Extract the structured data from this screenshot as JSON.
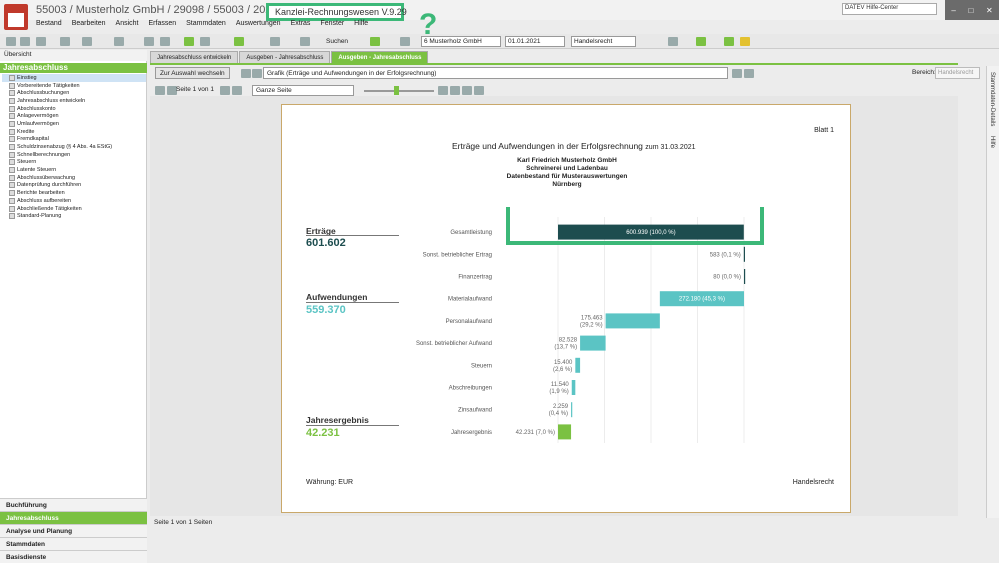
{
  "window": {
    "title": "55003 / Musterholz GmbH / 29098 / 55003 / 2021 - JA",
    "version": "Kanzlei-Rechnungswesen V.9.29",
    "help_center": "DATEV Hilfe-Center",
    "annotation_mark": "?"
  },
  "menu": [
    "Bestand",
    "Bearbeiten",
    "Ansicht",
    "Erfassen",
    "Stammdaten",
    "Auswertungen",
    "Extras",
    "Fenster",
    "Hilfe"
  ],
  "toolbar": {
    "search_label": "Suchen",
    "client": "6 Musterholz GmbH",
    "date": "01.01.2021",
    "law": "Handelsrecht"
  },
  "left": {
    "overview": "Übersicht",
    "section": "Jahresabschluss",
    "tree": [
      "Einstieg",
      "Vorbereitende Tätigkeiten",
      "Abschlussbuchungen",
      "Jahresabschluss entwickeln",
      "Abschlusskonto",
      "Anlagevermögen",
      "Umlaufvermögen",
      "Kredite",
      "Fremdkapital",
      "Schuldzinsenabzug (§ 4 Abs. 4a EStG)",
      "Schnellberechnungen",
      "Steuern",
      "Latente Steuern",
      "Abschlussüberwachung",
      "Datenprüfung durchführen",
      "Berichte bearbeiten",
      "Abschluss aufbereiten",
      "Abschließende Tätigkeiten",
      "Standard-Planung"
    ],
    "nav": [
      "Buchführung",
      "Jahresabschluss",
      "Analyse und Planung",
      "Stammdaten",
      "Basisdienste"
    ]
  },
  "tabs": [
    "Jahresabschluss entwickeln",
    "Ausgeben - Jahresabschluss",
    "Ausgeben - Jahresabschluss"
  ],
  "viewer": {
    "back_button": "Zur Auswahl wechseln",
    "report": "Grafik (Erträge und Aufwendungen in der Erfolgsrechnung)",
    "bereich_label": "Bereich:",
    "bereich_value": "Handelsrecht",
    "page_info": "Seite 1 von 1",
    "zoom": "Ganze Seite"
  },
  "right_strip": [
    "Stammdaten-Details",
    "Hilfe"
  ],
  "status": "Seite 1 von 1 Seiten",
  "report": {
    "sheet": "Blatt 1",
    "title": "Erträge und Aufwendungen in der Erfolgsrechnung",
    "date_suffix": "zum 31.03.2021",
    "company": [
      "Karl Friedrich Musterholz GmbH",
      "Schreinerei und Ladenbau",
      "Datenbestand für Musterauswertungen",
      "Nürnberg"
    ],
    "summary": [
      {
        "label": "Erträge",
        "value": "601.602",
        "color": "#1d4d4f"
      },
      {
        "label": "Aufwendungen",
        "value": "559.370",
        "color": "#5bc4c4"
      },
      {
        "label": "Jahresergebnis",
        "value": "42.231",
        "color": "#7bc142"
      }
    ],
    "currency": "Währung: EUR",
    "law": "Handelsrecht"
  },
  "chart_data": {
    "type": "bar",
    "categories": [
      "Gesamtleistung",
      "Sonst. betrieblicher Ertrag",
      "Finanzertrag",
      "Materialaufwand",
      "Personalaufwand",
      "Sonst. betrieblicher Aufwand",
      "Steuern",
      "Abschreibungen",
      "Zinsaufwand",
      "Jahresergebnis"
    ],
    "values": [
      600939,
      583,
      80,
      272180,
      175463,
      82528,
      15400,
      11540,
      2259,
      42231
    ],
    "labels": [
      "600.939 (100,0 %)",
      "583 (0,1 %)",
      "80 (0,0 %)",
      "272.180 (45,3 %)",
      "175.463|(29,2 %)",
      "82.528|(13,7 %)",
      "15.400|(2,6 %)",
      "11.540|(1,9 %)",
      "2.259|(0,4 %)",
      "42.231 (7,0 %)"
    ],
    "colors": [
      "#1d4d4f",
      "#1d4d4f",
      "#1d4d4f",
      "#5bc4c4",
      "#5bc4c4",
      "#5bc4c4",
      "#5bc4c4",
      "#5bc4c4",
      "#5bc4c4",
      "#7bc142"
    ],
    "xlim": [
      0,
      601602
    ],
    "highlight_category": "Gesamtleistung"
  }
}
